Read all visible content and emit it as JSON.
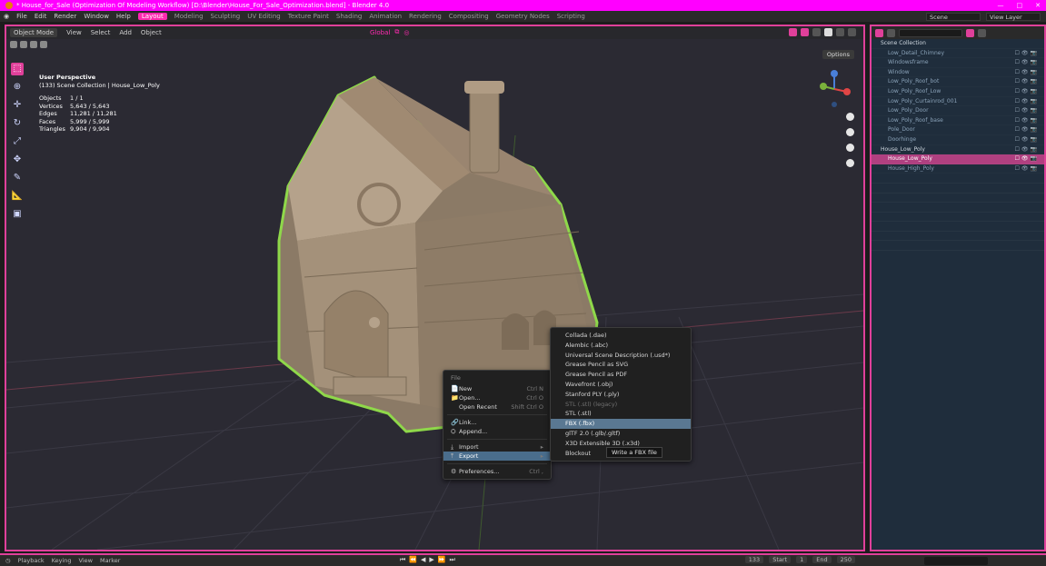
{
  "titlebar": {
    "text": "* House_for_Sale (Optimization Of Modeling Workflow) [D:\\Blender\\House_For_Sale_Optimization.blend] - Blender 4.0",
    "controls": [
      "—",
      "□",
      "✕"
    ]
  },
  "menubar": {
    "menus": [
      "File",
      "Edit",
      "Render",
      "Window",
      "Help"
    ],
    "tabs": [
      "Layout",
      "Modeling",
      "Sculpting",
      "UV Editing",
      "Texture Paint",
      "Shading",
      "Animation",
      "Rendering",
      "Compositing",
      "Geometry Nodes",
      "Scripting"
    ],
    "active_tab": "Layout",
    "scene_label": "Scene",
    "view_layer_label": "View Layer"
  },
  "viewport": {
    "header": {
      "mode": "Object Mode",
      "menus": [
        "View",
        "Select",
        "Add",
        "Object"
      ],
      "transform": "Global"
    },
    "info": {
      "title": "User Perspective",
      "collection": "(133) Scene Collection | House_Low_Poly",
      "stats": [
        {
          "label": "Objects",
          "value": "1 / 1"
        },
        {
          "label": "Vertices",
          "value": "5,643 / 5,643"
        },
        {
          "label": "Edges",
          "value": "11,281 / 11,281"
        },
        {
          "label": "Faces",
          "value": "5,999 / 5,999"
        },
        {
          "label": "Triangles",
          "value": "9,904 / 9,904"
        }
      ]
    },
    "options_label": "Options"
  },
  "file_menu": {
    "header": "File",
    "items": [
      {
        "icon": "📄",
        "label": "New",
        "shortcut": "Ctrl N"
      },
      {
        "icon": "📁",
        "label": "Open...",
        "shortcut": "Ctrl O"
      },
      {
        "icon": "",
        "label": "Open Recent",
        "shortcut": "Shift Ctrl O"
      },
      {
        "icon": "🔗",
        "label": "Link...",
        "shortcut": ""
      },
      {
        "icon": "⛭",
        "label": "Append...",
        "shortcut": ""
      },
      {
        "icon": "⤓",
        "label": "Import",
        "shortcut": "▸"
      },
      {
        "icon": "⤒",
        "label": "Export",
        "shortcut": "▸"
      },
      {
        "icon": "⚙",
        "label": "Preferences...",
        "shortcut": "Ctrl ,"
      }
    ]
  },
  "export_menu": {
    "items": [
      "Collada (.dae)",
      "Alembic (.abc)",
      "Universal Scene Description (.usd*)",
      "Grease Pencil as SVG",
      "Grease Pencil as PDF",
      "Wavefront (.obj)",
      "Stanford PLY (.ply)",
      "STL (.stl) (legacy)",
      "STL (.stl)",
      "FBX (.fbx)",
      "glTF 2.0 (.glb/.gltf)",
      "X3D Extensible 3D (.x3d)",
      "Blockout"
    ],
    "highlighted": "FBX (.fbx)",
    "tooltip": "Write a FBX file"
  },
  "outliner": {
    "rows": [
      {
        "label": "Scene Collection",
        "type": "top"
      },
      {
        "label": "Low_Detail_Chimney",
        "type": "child"
      },
      {
        "label": "Windowsframe",
        "type": "child"
      },
      {
        "label": "Window",
        "type": "child"
      },
      {
        "label": "Low_Poly_Roof_bot",
        "type": "child"
      },
      {
        "label": "Low_Poly_Roof_Low",
        "type": "child"
      },
      {
        "label": "Low_Poly_Curtainrod_001",
        "type": "child"
      },
      {
        "label": "Low_Poly_Door",
        "type": "child"
      },
      {
        "label": "Low_Poly_Roof_base",
        "type": "child"
      },
      {
        "label": "Pole_Door",
        "type": "child"
      },
      {
        "label": "Doorhinge",
        "type": "child"
      },
      {
        "label": "House_Low_Poly",
        "type": "top"
      },
      {
        "label": "House_Low_Poly",
        "type": "selected"
      },
      {
        "label": "House_High_Poly",
        "type": "child"
      }
    ]
  },
  "timeline": {
    "menus": [
      "Playback",
      "Keying",
      "View",
      "Marker"
    ],
    "buttons": [
      "⏮",
      "⏪",
      "◀",
      "▶",
      "⏩",
      "⏭"
    ],
    "current_frame": "133",
    "start_label": "Start",
    "start": "1",
    "end_label": "End",
    "end": "250"
  },
  "colors": {
    "accent": "#e0409a",
    "titlebar": "#ff00ff",
    "selection": "#4a6d8c",
    "outline": "#7ec850"
  }
}
